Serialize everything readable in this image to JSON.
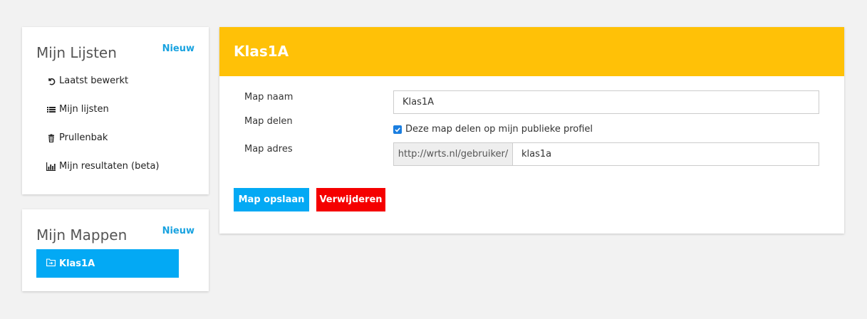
{
  "sidebar": {
    "lists": {
      "title": "Mijn Lijsten",
      "new_label": "Nieuw",
      "items": [
        {
          "label": "Laatst bewerkt",
          "icon": "undo-icon"
        },
        {
          "label": "Mijn lijsten",
          "icon": "list-icon"
        },
        {
          "label": "Prullenbak",
          "icon": "trash-icon"
        },
        {
          "label": "Mijn resultaten (beta)",
          "icon": "bar-chart-icon"
        }
      ]
    },
    "folders": {
      "title": "Mijn Mappen",
      "new_label": "Nieuw",
      "items": [
        {
          "label": "Klas1A",
          "icon": "folder-icon",
          "selected": true
        }
      ]
    }
  },
  "main": {
    "title": "Klas1A",
    "form": {
      "name_label": "Map naam",
      "name_value": "Klas1A",
      "share_label": "Map delen",
      "share_checkbox_label": "Deze map delen op mijn publieke profiel",
      "share_checked": true,
      "address_label": "Map adres",
      "address_prefix": "http://wrts.nl/gebruiker/",
      "address_value": "klas1a"
    },
    "buttons": {
      "save_label": "Map opslaan",
      "delete_label": "Verwijderen"
    }
  },
  "colors": {
    "header": "#ffc107",
    "primary": "#03a9f4",
    "danger": "#f50000",
    "link": "#1aa3e0"
  }
}
